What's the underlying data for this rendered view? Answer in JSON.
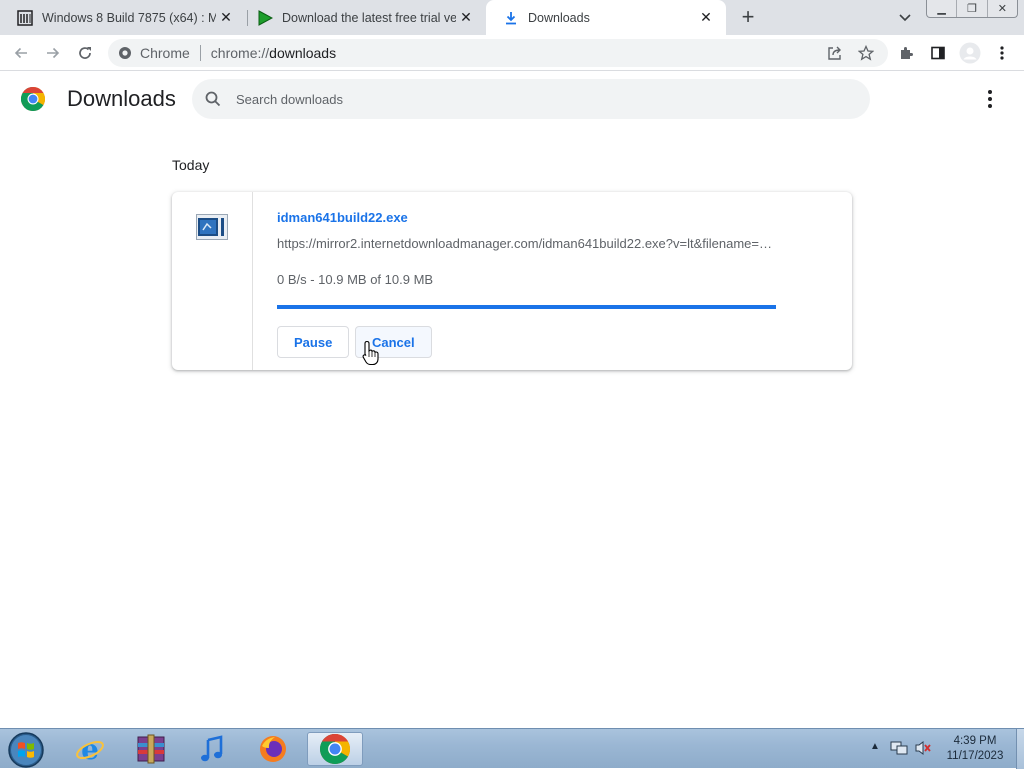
{
  "browser": {
    "tabs": [
      {
        "title": "Windows 8 Build 7875 (x64) : Mic",
        "icon": "archive-icon",
        "active": false
      },
      {
        "title": "Download the latest free trial ver",
        "icon": "idm-play-icon",
        "active": false
      },
      {
        "title": "Downloads",
        "icon": "download-icon",
        "active": true
      }
    ],
    "omnibox": {
      "chip_label": "Chrome",
      "url_scheme": "chrome://",
      "url_path": "downloads"
    }
  },
  "page": {
    "title": "Downloads",
    "search_placeholder": "Search downloads",
    "date_heading": "Today",
    "download": {
      "file_name": "idman641build22.exe",
      "url": "https://mirror2.internetdownloadmanager.com/idman641build22.exe?v=lt&filename=…",
      "status": "0 B/s - 10.9 MB of 10.9 MB",
      "progress": 1.0,
      "pause_label": "Pause",
      "cancel_label": "Cancel"
    }
  },
  "taskbar": {
    "apps": [
      "internet-explorer",
      "winrar",
      "itunes",
      "firefox",
      "chrome"
    ],
    "clock_time": "4:39 PM",
    "clock_date": "11/17/2023"
  },
  "colors": {
    "accent": "#1a73e8",
    "tabstrip": "#dee1e6"
  }
}
